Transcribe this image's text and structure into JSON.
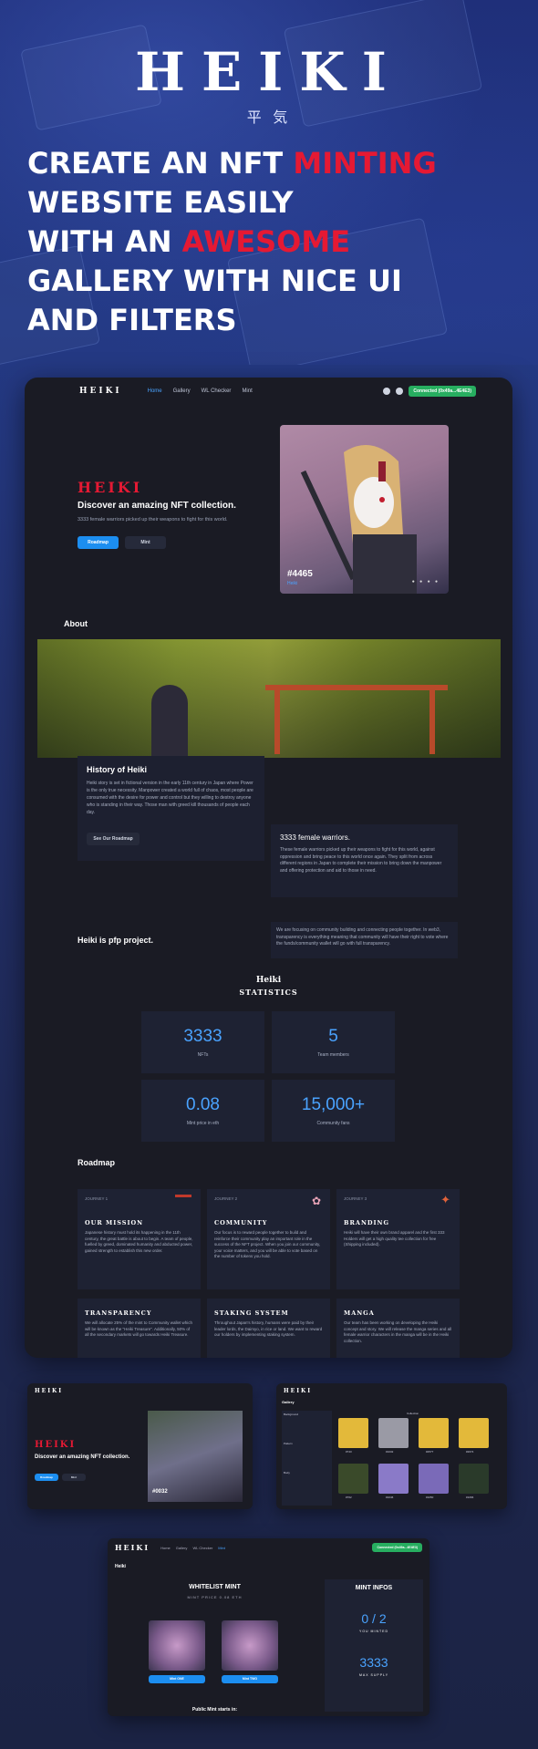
{
  "hero": {
    "logo": "HEIKI",
    "logo_sub": "平 気",
    "headline_1a": "CREATE AN NFT ",
    "headline_1b": "MINTING",
    "headline_2": "WEBSITE EASILY",
    "headline_3a": "WITH AN ",
    "headline_3b": "AWESOME",
    "headline_4": "GALLERY WITH NICE UI",
    "headline_5": "AND FILTERS"
  },
  "nav": {
    "logo": "HEIKI",
    "items": [
      "Home",
      "Gallery",
      "WL Checker",
      "Mint"
    ],
    "connect": "Connected (0x49a...4E4E3)"
  },
  "main_hero": {
    "brand": "HEIKI",
    "title": "Discover an amazing NFT collection.",
    "desc": "3333 female warriors picked up their weapons to fight for this world.",
    "btn_roadmap": "Roadmap",
    "btn_mint": "Mint",
    "nft_number": "#4465",
    "nft_sub": "Heiki"
  },
  "about": {
    "title": "About",
    "history_title": "History of Heiki",
    "history_text": "Heiki story is set in fictional version in the early 11th century in Japan where Power is the only true necessity. Manpower created a world full of chaos, most people are consumed with the desire for power and control but they willing to destroy anyone who is standing in their way. Those man with greed kill thousands of people each day.",
    "history_btn": "See Our Roadmap",
    "warriors_title": "3333 female warriors.",
    "warriors_text": "These female warriors picked up their weapons to fight for this world, against oppression and bring peace to this world once again. They split from across different regions in Japan to complete their mission to bring down the manpower and offering protection and aid to those in need.",
    "pfp_title": "Heiki is pfp project.",
    "pfp_text": "We are focusing on community building and connecting people together. In web3, transparency is everything meaning that community will have their right to vote where the funds/community wallet will go with full transparency."
  },
  "stats": {
    "title_1": "Heiki",
    "title_2": "STATISTICS",
    "items": [
      {
        "value": "3333",
        "label": "NFTs"
      },
      {
        "value": "5",
        "label": "Team members"
      },
      {
        "value": "0.08",
        "label": "Mint price in eth"
      },
      {
        "value": "15,000+",
        "label": "Community fans"
      }
    ]
  },
  "roadmap": {
    "title": "Roadmap",
    "cards": [
      {
        "journey": "JOURNEY 1",
        "title": "OUR MISSION",
        "text": "Japanese history must hold its happening in the 11th century, the great battle is about to begin. A team of people, fuelled by greed, dominated humanity and abducted power, gained strength to establish this new order."
      },
      {
        "journey": "JOURNEY 2",
        "title": "COMMUNITY",
        "text": "Our focus is to reward people together to build and reinforce their community play an important role in the success of the NFT project. When you join our community, your voice matters, and you will be able to vote based on the number of tokens you hold."
      },
      {
        "journey": "JOURNEY 3",
        "title": "BRANDING",
        "text": "Heiki will have their own brand apparel and the first 333 Holders will get a high quality tee collection for free (Shipping included)."
      },
      {
        "journey": "",
        "title": "TRANSPARENCY",
        "text": "We will allocate 25% of the mint to Community wallet which will be known as the \"Heiki Treasure\". Additionally, 50% of all the secondary markets will go towards Heiki Treasure."
      },
      {
        "journey": "",
        "title": "STAKING SYSTEM",
        "text": "Throughout Japan's history, humans were paid by their leader lords, the Daimyo, in rice or land. We want to reward our holders by implementing staking system."
      },
      {
        "journey": "",
        "title": "MANGA",
        "text": "Our team has been working on developing the Heiki concept and story. We will release the manga series and all female warrior characters in the manga will be in the Heiki collection."
      }
    ]
  },
  "thumb_hero": {
    "brand": "HEIKI",
    "title": "Discover an amazing NFT collection.",
    "nft_number": "#0032",
    "btn1": "Roadmap",
    "btn2": "Mint"
  },
  "thumb_gallery": {
    "title": "Gallery",
    "filter_bg": "Background",
    "filter_pattern": "Pattern",
    "filter_body": "Body",
    "collection": "Collection",
    "items": [
      "#743",
      "#1032",
      "#2577",
      "#2674",
      "#762",
      "#1046",
      "#1050",
      "#1066"
    ]
  },
  "thumb_mint": {
    "brand": "HEIKI",
    "nav": [
      "Home",
      "Gallery",
      "WL Checker",
      "Mint"
    ],
    "connect": "Connected (0x49a...4E4E3)",
    "page_label": "Heiki",
    "wl_title": "WHITELIST MINT",
    "wl_sub": "MINT PRICE 0.08 ETH",
    "mint_btn_1": "Mint ONE",
    "mint_btn_2": "Mint TWO",
    "infos_title": "MINT INFOS",
    "minted": "0 / 2",
    "minted_label": "YOU MINTED",
    "supply": "3333",
    "supply_label": "MAX SUPPLY",
    "public": "Public Mint starts in:"
  },
  "colors": {
    "accent_blue": "#4aa3ff",
    "accent_red": "#e51933",
    "connect_green": "#27ae60",
    "panel": "#1e2233"
  }
}
